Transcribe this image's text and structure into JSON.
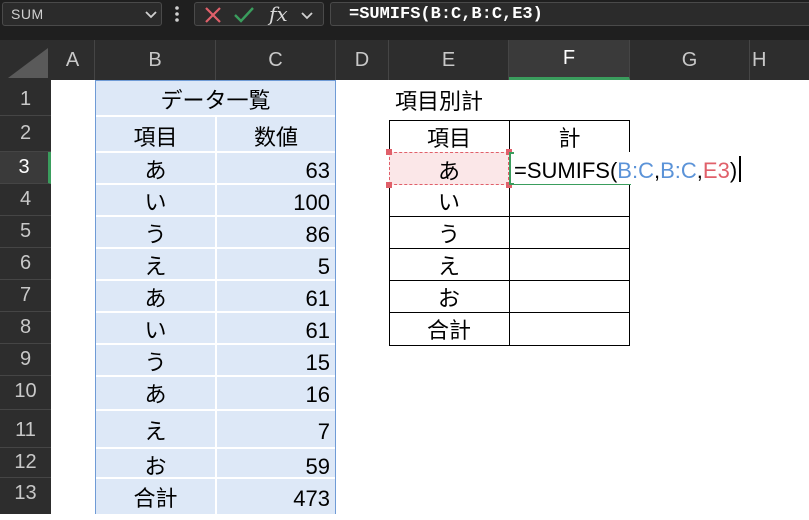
{
  "formula_bar": {
    "name_box": "SUM",
    "fx_label": "fx",
    "formula": "=SUMIFS(B:C,B:C,E3)"
  },
  "columns": [
    "A",
    "B",
    "C",
    "D",
    "E",
    "F",
    "G",
    "H"
  ],
  "rows": [
    "1",
    "2",
    "3",
    "4",
    "5",
    "6",
    "7",
    "8",
    "9",
    "10",
    "11",
    "12",
    "13"
  ],
  "data_table": {
    "title": "データ一覧",
    "headers": [
      "項目",
      "数値"
    ],
    "items": [
      {
        "item": "あ",
        "value": "63"
      },
      {
        "item": "い",
        "value": "100"
      },
      {
        "item": "う",
        "value": "86"
      },
      {
        "item": "え",
        "value": "5"
      },
      {
        "item": "あ",
        "value": "61"
      },
      {
        "item": "い",
        "value": "61"
      },
      {
        "item": "う",
        "value": "15"
      },
      {
        "item": "あ",
        "value": "16"
      },
      {
        "item": "え",
        "value": "7"
      },
      {
        "item": "お",
        "value": "59"
      }
    ],
    "total_label": "合計",
    "total_value": "473"
  },
  "summary_table": {
    "title": "項目別計",
    "headers": [
      "項目",
      "計"
    ],
    "items": [
      "あ",
      "い",
      "う",
      "え",
      "お"
    ],
    "total_label": "合計"
  },
  "active_edit": {
    "eq": "=SUMIFS(",
    "ref1": "B:C",
    "sep1": ",",
    "ref2": "B:C",
    "sep2": ",",
    "ref3": "E3",
    "close": ")"
  },
  "colors": {
    "green_accent": "#3a9d5d",
    "ref_blue": "#5b93d8",
    "ref_red": "#e0606a",
    "blue_fill": "#dde8f7",
    "pink_fill": "#fbe7e8"
  }
}
